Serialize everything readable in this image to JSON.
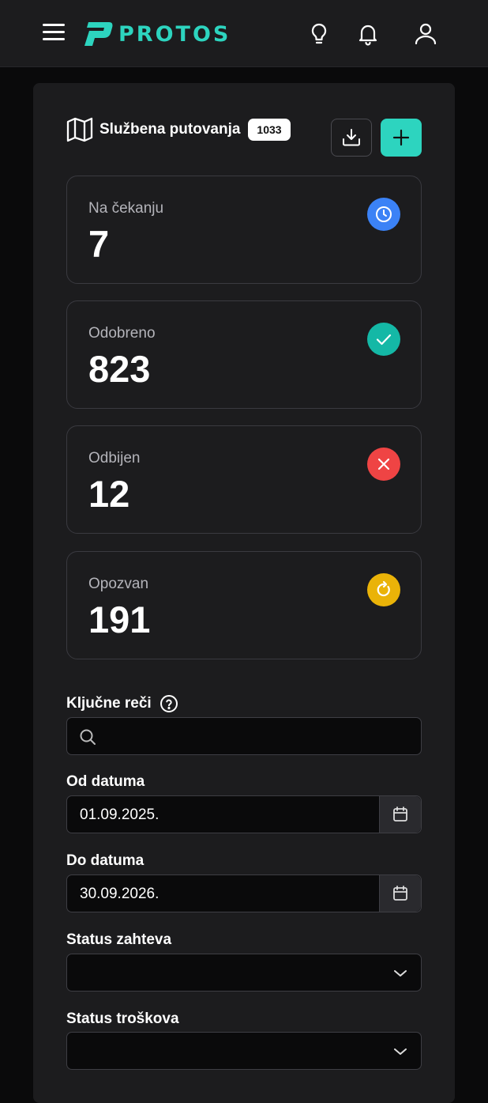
{
  "brand": {
    "name": "PROTOS",
    "color": "#2dd4bf"
  },
  "header": {
    "title": "Službena putovanja",
    "count": "1033"
  },
  "stats": [
    {
      "label": "Na čekanju",
      "value": "7",
      "icon": "clock-icon",
      "color": "#3b82f6"
    },
    {
      "label": "Odobreno",
      "value": "823",
      "icon": "check-icon",
      "color": "#14b8a6"
    },
    {
      "label": "Odbijen",
      "value": "12",
      "icon": "x-icon",
      "color": "#ef4444"
    },
    {
      "label": "Opozvan",
      "value": "191",
      "icon": "refresh-icon",
      "color": "#eab308"
    }
  ],
  "filters": {
    "keywords_label": "Ključne reči",
    "keywords_value": "",
    "from_label": "Od datuma",
    "from_value": "01.09.2025.",
    "to_label": "Do datuma",
    "to_value": "30.09.2026.",
    "request_status_label": "Status zahteva",
    "request_status_value": "",
    "cost_status_label": "Status troškova",
    "cost_status_value": ""
  }
}
